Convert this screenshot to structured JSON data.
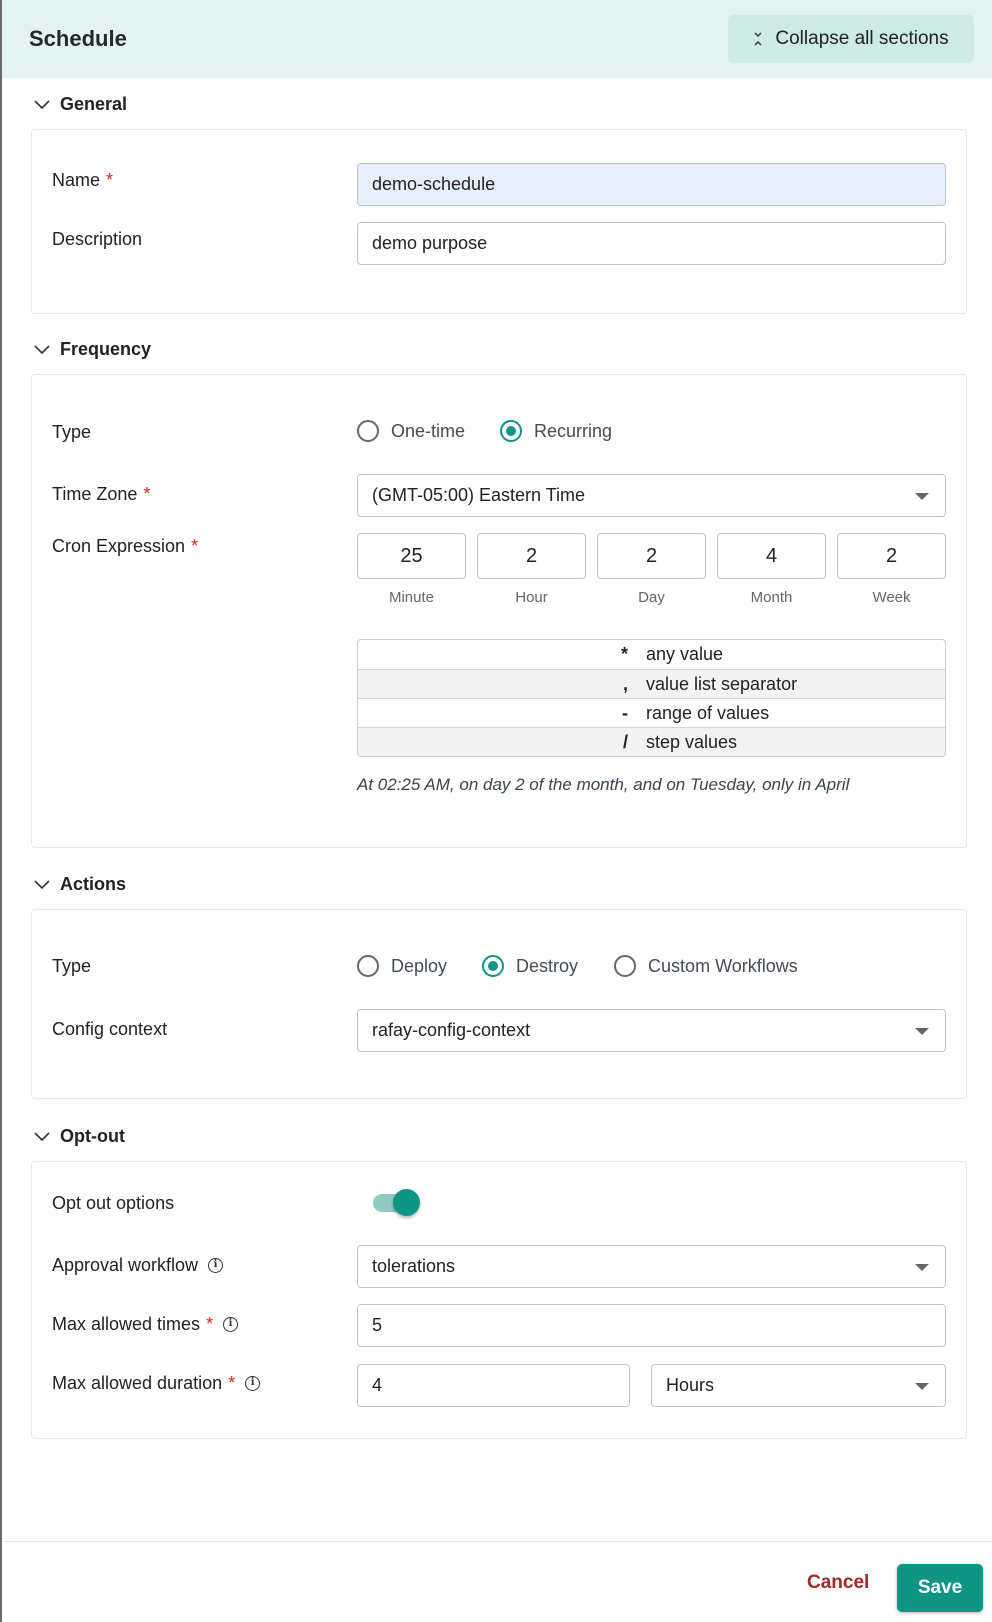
{
  "header": {
    "title": "Schedule",
    "collapse_label": "Collapse all sections"
  },
  "general": {
    "title": "General",
    "name_label": "Name",
    "name_value": "demo-schedule",
    "description_label": "Description",
    "description_value": "demo purpose"
  },
  "frequency": {
    "title": "Frequency",
    "type_label": "Type",
    "type_options": [
      "One-time",
      "Recurring"
    ],
    "type_selected": "Recurring",
    "timezone_label": "Time Zone",
    "timezone_value": "(GMT-05:00) Eastern Time",
    "cron_label": "Cron Expression",
    "cron_fields": [
      {
        "value": "25",
        "label": "Minute"
      },
      {
        "value": "2",
        "label": "Hour"
      },
      {
        "value": "2",
        "label": "Day"
      },
      {
        "value": "4",
        "label": "Month"
      },
      {
        "value": "2",
        "label": "Week"
      }
    ],
    "legend": [
      {
        "symbol": "*",
        "description": "any value"
      },
      {
        "symbol": ",",
        "description": "value list separator"
      },
      {
        "symbol": "-",
        "description": "range of values"
      },
      {
        "symbol": "/",
        "description": "step values"
      }
    ],
    "cron_description": "At 02:25 AM, on day 2 of the month, and on Tuesday, only in April"
  },
  "actions": {
    "title": "Actions",
    "type_label": "Type",
    "type_options": [
      "Deploy",
      "Destroy",
      "Custom Workflows"
    ],
    "type_selected": "Destroy",
    "config_label": "Config context",
    "config_value": "rafay-config-context"
  },
  "optout": {
    "title": "Opt-out",
    "options_label": "Opt out options",
    "options_enabled": true,
    "approval_label": "Approval workflow",
    "approval_value": "tolerations",
    "max_times_label": "Max allowed times",
    "max_times_value": "5",
    "max_duration_label": "Max allowed duration",
    "max_duration_value": "4",
    "max_duration_unit": "Hours"
  },
  "footer": {
    "cancel_label": "Cancel",
    "save_label": "Save"
  },
  "required_marker": "*",
  "info_glyph": "i"
}
